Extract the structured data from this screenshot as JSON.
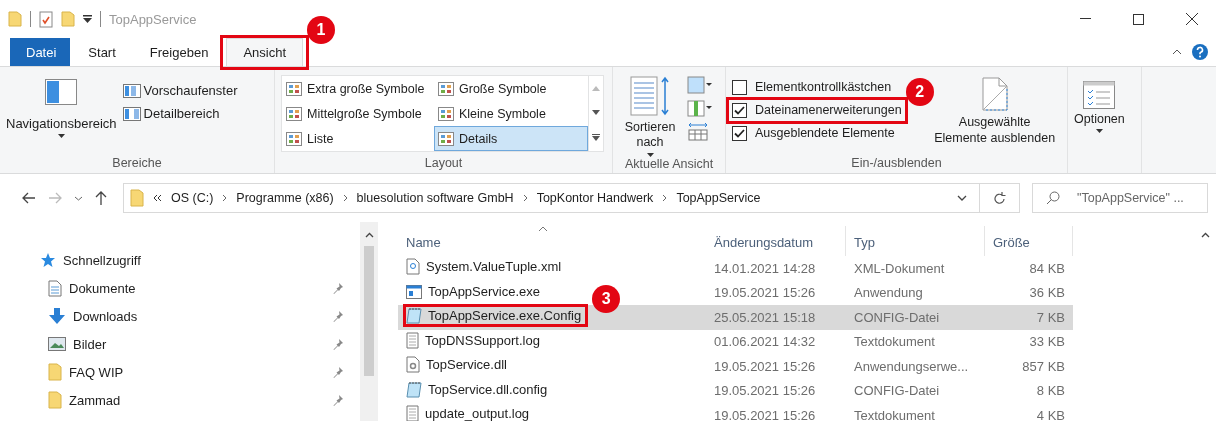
{
  "title_bar": {
    "title": "TopAppService"
  },
  "tabs": [
    {
      "label": "Datei",
      "kind": "file",
      "selected": false
    },
    {
      "label": "Start",
      "kind": "tab",
      "selected": false
    },
    {
      "label": "Freigeben",
      "kind": "tab",
      "selected": false
    },
    {
      "label": "Ansicht",
      "kind": "tab",
      "selected": true,
      "callout": "1"
    }
  ],
  "panes": {
    "label": "Bereiche",
    "navigation": "Navigationsbereich",
    "items": [
      "Vorschaufenster",
      "Detailbereich"
    ]
  },
  "layout": {
    "label": "Layout",
    "options": [
      {
        "label": "Extra große Symbole",
        "selected": false
      },
      {
        "label": "Große Symbole",
        "selected": false
      },
      {
        "label": "Mittelgroße Symbole",
        "selected": false
      },
      {
        "label": "Kleine Symbole",
        "selected": false
      },
      {
        "label": "Liste",
        "selected": false
      },
      {
        "label": "Details",
        "selected": true
      }
    ]
  },
  "current_view": {
    "label": "Aktuelle Ansicht",
    "sort": "Sortieren nach"
  },
  "show_hide": {
    "label": "Ein-/ausblenden",
    "checkboxes": [
      {
        "label": "Elementkontrollkästchen",
        "checked": false
      },
      {
        "label": "Dateinamenerweiterungen",
        "checked": true,
        "callout": "2"
      },
      {
        "label": "Ausgeblendete Elemente",
        "checked": true
      }
    ],
    "hide_selected": "Ausgewählte Elemente ausblenden"
  },
  "options": {
    "label": "Optionen"
  },
  "address": {
    "crumbs": [
      "OS (C:)",
      "Programme (x86)",
      "bluesolution software GmbH",
      "TopKontor Handwerk",
      "TopAppService"
    ],
    "search_placeholder": "\"TopAppService\" ..."
  },
  "sidebar": {
    "items": [
      {
        "label": "Schnellzugriff",
        "kind": "star",
        "pinned": false
      },
      {
        "label": "Dokumente",
        "kind": "docs",
        "pinned": true
      },
      {
        "label": "Downloads",
        "kind": "download",
        "pinned": true
      },
      {
        "label": "Bilder",
        "kind": "pictures",
        "pinned": true
      },
      {
        "label": "FAQ WIP",
        "kind": "folder",
        "pinned": true
      },
      {
        "label": "Zammad",
        "kind": "folder",
        "pinned": true
      }
    ]
  },
  "table": {
    "columns": [
      "Name",
      "Änderungsdatum",
      "Typ",
      "Größe"
    ],
    "rows": [
      {
        "name": "System.ValueTuple.xml",
        "kind": "xml",
        "date": "14.01.2021 14:28",
        "type": "XML-Dokument",
        "size": "84 KB",
        "selected": false
      },
      {
        "name": "TopAppService.exe",
        "kind": "exe",
        "date": "19.05.2021 15:26",
        "type": "Anwendung",
        "size": "36 KB",
        "selected": false
      },
      {
        "name": "TopAppService.exe.Config",
        "kind": "config",
        "date": "25.05.2021 15:18",
        "type": "CONFIG-Datei",
        "size": "7 KB",
        "selected": true,
        "callout": "3"
      },
      {
        "name": "TopDNSSupport.log",
        "kind": "text",
        "date": "01.06.2021 14:32",
        "type": "Textdokument",
        "size": "33 KB",
        "selected": false
      },
      {
        "name": "TopService.dll",
        "kind": "dll",
        "date": "19.05.2021 15:26",
        "type": "Anwendungserwe...",
        "size": "857 KB",
        "selected": false
      },
      {
        "name": "TopService.dll.config",
        "kind": "config",
        "date": "19.05.2021 15:26",
        "type": "CONFIG-Datei",
        "size": "8 KB",
        "selected": false
      },
      {
        "name": "update_output.log",
        "kind": "text",
        "date": "19.05.2021 15:26",
        "type": "Textdokument",
        "size": "4 KB",
        "selected": false
      }
    ]
  }
}
